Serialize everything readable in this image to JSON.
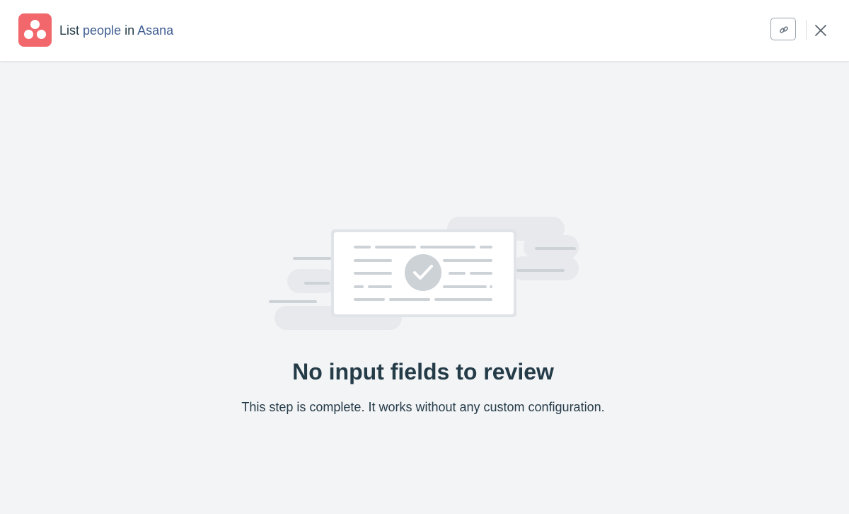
{
  "header": {
    "app_name": "Asana",
    "app_icon": "asana-logo-icon",
    "title_parts": {
      "action": "List",
      "object": "people",
      "connector": "in",
      "app": "Asana"
    },
    "copy_link_icon": "link-icon",
    "close_icon": "close-icon"
  },
  "empty_state": {
    "illustration_icon": "document-check-icon",
    "title": "No input fields to review",
    "description": "This step is complete. It works without any custom configuration."
  },
  "colors": {
    "brand_asana": "#f2676c",
    "link_pill": "#3f5d92",
    "text_primary": "#243b48",
    "background": "#f3f4f6"
  }
}
